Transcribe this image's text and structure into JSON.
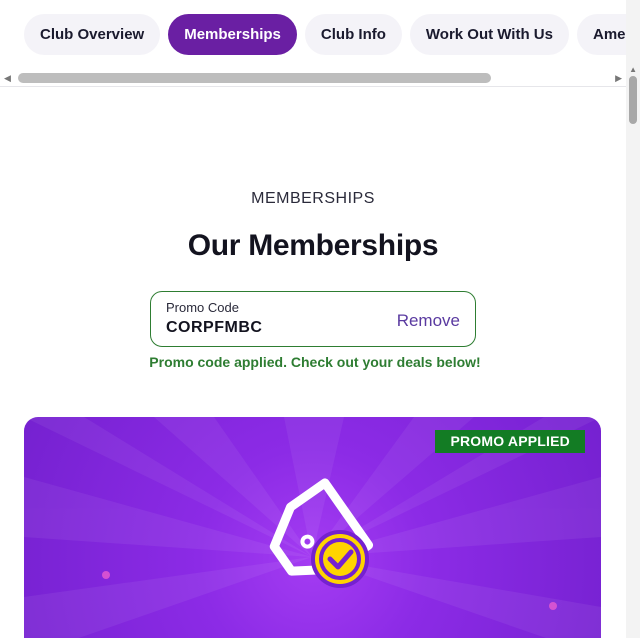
{
  "tabs": [
    {
      "label": "Club Overview",
      "active": false
    },
    {
      "label": "Memberships",
      "active": true
    },
    {
      "label": "Club Info",
      "active": false
    },
    {
      "label": "Work Out With Us",
      "active": false
    },
    {
      "label": "Amenit",
      "active": false
    }
  ],
  "section": {
    "eyebrow": "MEMBERSHIPS",
    "heading": "Our Memberships"
  },
  "promo": {
    "label": "Promo Code",
    "code": "CORPFMBC",
    "remove_label": "Remove",
    "message": "Promo code applied. Check out your deals below!"
  },
  "banner": {
    "badge": "PROMO APPLIED",
    "icon": "tag-check-icon"
  },
  "colors": {
    "brand_purple": "#6a1fa3",
    "banner_purple": "#8c2be6",
    "success_green": "#2e7d32",
    "badge_green": "#137c24",
    "check_yellow": "#ffd400"
  }
}
